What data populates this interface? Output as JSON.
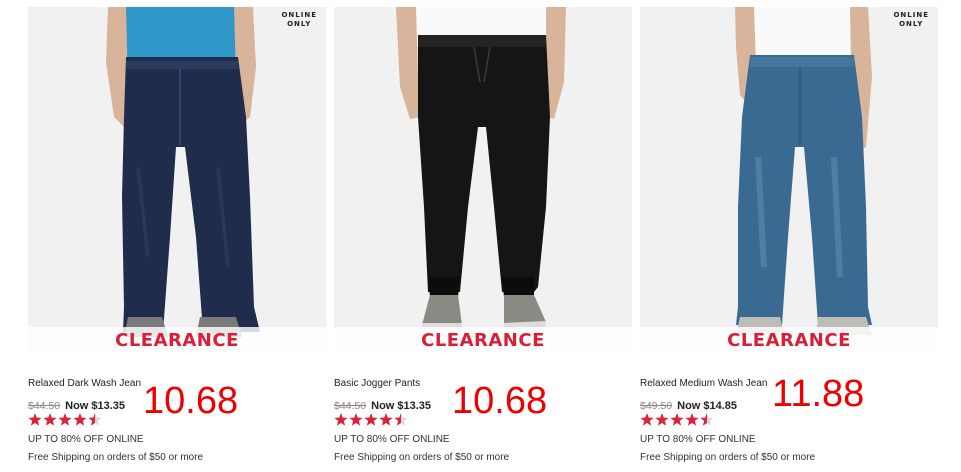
{
  "products": [
    {
      "name": "Relaxed Dark Wash Jean",
      "old_price": "$44.50",
      "now_price": "Now $13.35",
      "overlay_price": "10.68",
      "online_badge": [
        "ONLINE",
        "ONLY"
      ],
      "banner": "CLEARANCE",
      "rating": 4.5,
      "promo": "UP TO 80% OFF ONLINE",
      "shipping": "Free Shipping on orders of $50 or more"
    },
    {
      "name": "Basic Jogger Pants",
      "old_price": "$44.50",
      "now_price": "Now $13.35",
      "overlay_price": "10.68",
      "online_badge": null,
      "banner": "CLEARANCE",
      "rating": 4.5,
      "promo": "UP TO 80% OFF ONLINE",
      "shipping": "Free Shipping on orders of $50 or more"
    },
    {
      "name": "Relaxed Medium Wash Jean",
      "old_price": "$49.50",
      "now_price": "Now $14.85",
      "overlay_price": "11.88",
      "online_badge": [
        "ONLINE",
        "ONLY"
      ],
      "banner": "CLEARANCE",
      "rating": 4.5,
      "promo": "UP TO 80% OFF ONLINE",
      "shipping": "Free Shipping on orders of $50 or more"
    }
  ],
  "colors": {
    "banner_text": "#d81f3a",
    "overlay_price": "#ee0000",
    "star": "#d8253c",
    "image_bg": "#f1f1f1"
  },
  "icons": {
    "star": "star-icon",
    "half_star": "half-star-icon"
  }
}
